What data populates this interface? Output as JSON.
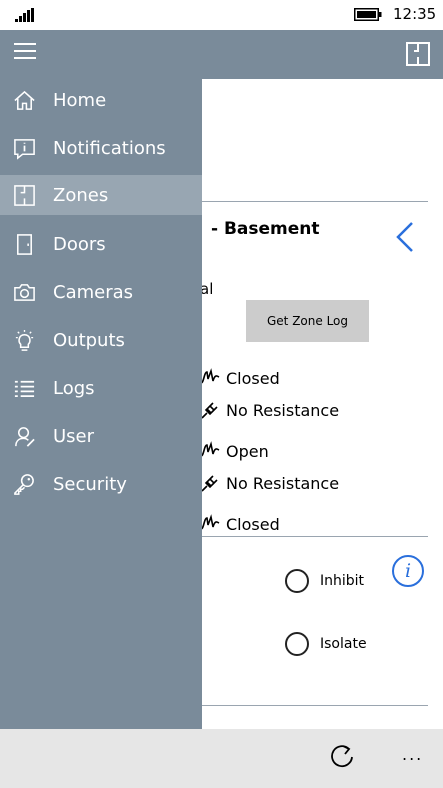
{
  "status": {
    "time": "12:35"
  },
  "nav": {
    "items": [
      {
        "label": "Home",
        "icon": "home-icon"
      },
      {
        "label": "Notifications",
        "icon": "notifications-icon"
      },
      {
        "label": "Zones",
        "icon": "zones-icon",
        "selected": true
      },
      {
        "label": "Doors",
        "icon": "door-icon"
      },
      {
        "label": "Cameras",
        "icon": "camera-icon"
      },
      {
        "label": "Outputs",
        "icon": "lightbulb-icon"
      },
      {
        "label": "Logs",
        "icon": "list-icon"
      },
      {
        "label": "User",
        "icon": "user-icon"
      },
      {
        "label": "Security",
        "icon": "key-icon"
      }
    ]
  },
  "zone": {
    "title": "- Basement",
    "partial_text": "al",
    "log_button": "Get Zone Log",
    "states": [
      {
        "text": "Closed",
        "icon": "circuit-icon"
      },
      {
        "text": "No Resistance",
        "icon": "plug-icon"
      },
      {
        "text": "Open",
        "icon": "circuit-icon"
      },
      {
        "text": "No Resistance",
        "icon": "plug-icon"
      },
      {
        "text": "Closed",
        "icon": "circuit-icon"
      }
    ],
    "options": {
      "inhibit": "Inhibit",
      "isolate": "Isolate"
    },
    "info_glyph": "i"
  },
  "bottom": {
    "more": "..."
  },
  "colors": {
    "drawer": "#7a8b9a",
    "selected": "#98a6b2",
    "accent": "#2a6fdc"
  }
}
